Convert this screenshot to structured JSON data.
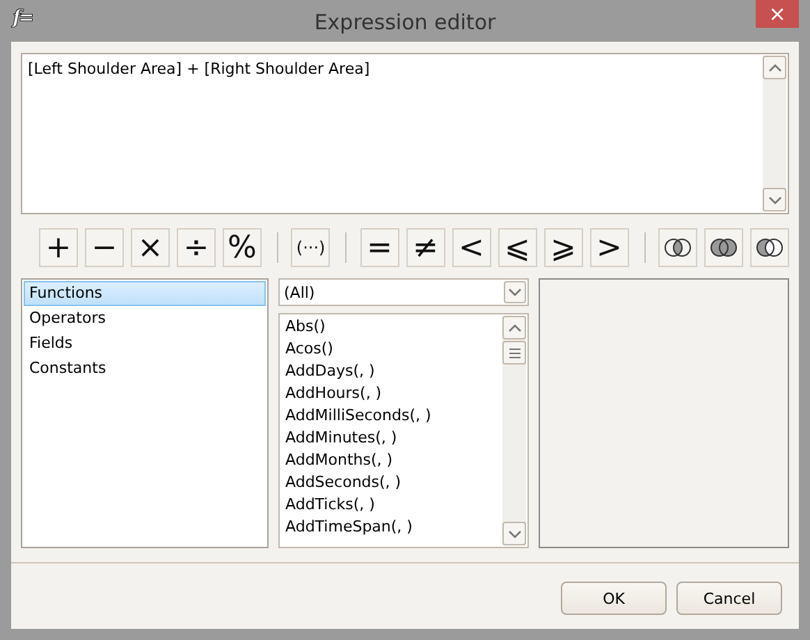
{
  "window": {
    "logo": "f=",
    "title": "Expression editor",
    "close": "×"
  },
  "expression": {
    "value": "[Left Shoulder Area] + [Right Shoulder Area]"
  },
  "toolbar": [
    [
      {
        "kind": "symbol",
        "label": "+"
      },
      {
        "kind": "symbol",
        "label": "−"
      },
      {
        "kind": "symbol",
        "label": "×"
      },
      {
        "kind": "symbol",
        "label": "÷"
      },
      {
        "kind": "symbol",
        "label": "%"
      }
    ],
    [
      {
        "kind": "symbol",
        "label": "(···)"
      }
    ],
    [
      {
        "kind": "symbol",
        "label": "="
      },
      {
        "kind": "symbol",
        "label": "≠"
      },
      {
        "kind": "symbol",
        "label": "<"
      },
      {
        "kind": "symbol",
        "label": "⩽"
      },
      {
        "kind": "symbol",
        "label": "⩾"
      },
      {
        "kind": "symbol",
        "label": ">"
      }
    ],
    [
      {
        "kind": "intersection"
      },
      {
        "kind": "union"
      },
      {
        "kind": "difference"
      }
    ]
  ],
  "categories": [
    {
      "label": "Functions",
      "selected": true
    },
    {
      "label": "Operators",
      "selected": false
    },
    {
      "label": "Fields",
      "selected": false
    },
    {
      "label": "Constants",
      "selected": false
    }
  ],
  "filter": {
    "value": "(All)"
  },
  "functions": [
    "Abs()",
    "Acos()",
    "AddDays(, )",
    "AddHours(, )",
    "AddMilliSeconds(, )",
    "AddMinutes(, )",
    "AddMonths(, )",
    "AddSeconds(, )",
    "AddTicks(, )",
    "AddTimeSpan(, )"
  ],
  "buttons": [
    "OK",
    "Cancel"
  ]
}
